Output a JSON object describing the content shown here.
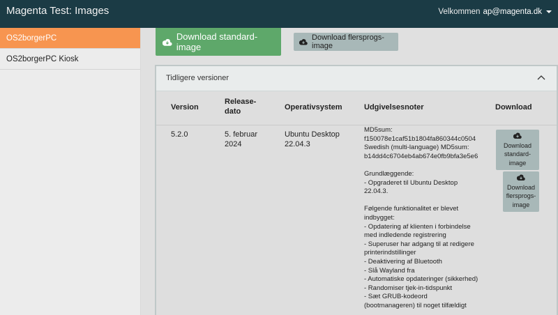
{
  "header": {
    "app_title": "Magenta Test: Images",
    "welcome_text": "Velkommen",
    "user_email": "ap@magenta.dk"
  },
  "sidebar": {
    "items": [
      {
        "label": "OS2borgerPC",
        "active": true
      },
      {
        "label": "OS2borgerPC Kiosk",
        "active": false
      }
    ]
  },
  "actions": {
    "download_standard_label": "Download standard-image",
    "download_multi_label": "Download flersprogs-image"
  },
  "versions": {
    "title": "Tidligere versioner",
    "columns": {
      "version": "Version",
      "release_date_line1": "Release-",
      "release_date_line2": "dato",
      "os": "Operativsystem",
      "notes": "Udgivelsesnoter",
      "download": "Download"
    },
    "row": {
      "version": "5.2.0",
      "date_line1": "5. februar",
      "date_line2": "2024",
      "os_line1": "Ubuntu Desktop",
      "os_line2": "22.04.3",
      "notes": [
        "MD5sum:",
        "f150078e1caf51b1804fa860344c0504",
        "Swedish (multi-language) MD5sum:",
        "b14dd4c6704eb4ab674e0fb9bfa3e5e6",
        "",
        "Grundlæggende:",
        "- Opgraderet til Ubuntu Desktop",
        "22.04.3.",
        "",
        "Følgende funktionalitet er blevet",
        "indbygget:",
        "- Opdatering af klienten i forbindelse",
        "med indledende registrering",
        "- Superuser har adgang til at redigere",
        "printerindstillinger",
        "- Deaktivering af Bluetooth",
        "- Slå Wayland fra",
        "- Automatiske opdateringer (sikkerhed)",
        "- Randomiser tjek-in-tidspunkt",
        "- Sæt GRUB-kodeord",
        "(bootmanageren) til noget tilfældigt"
      ],
      "download_standard": [
        "Download",
        "standard-",
        "image"
      ],
      "download_multi": [
        "Download",
        "flersprogs-",
        "image"
      ]
    }
  },
  "colors": {
    "topbar": "#1b3b45",
    "active_sidebar": "#f79550",
    "primary_button": "#5ea86a",
    "secondary_button": "#a8b8b8"
  },
  "icons": [
    "cloud-download-icon",
    "chevron-up-icon",
    "caret-down-icon"
  ]
}
